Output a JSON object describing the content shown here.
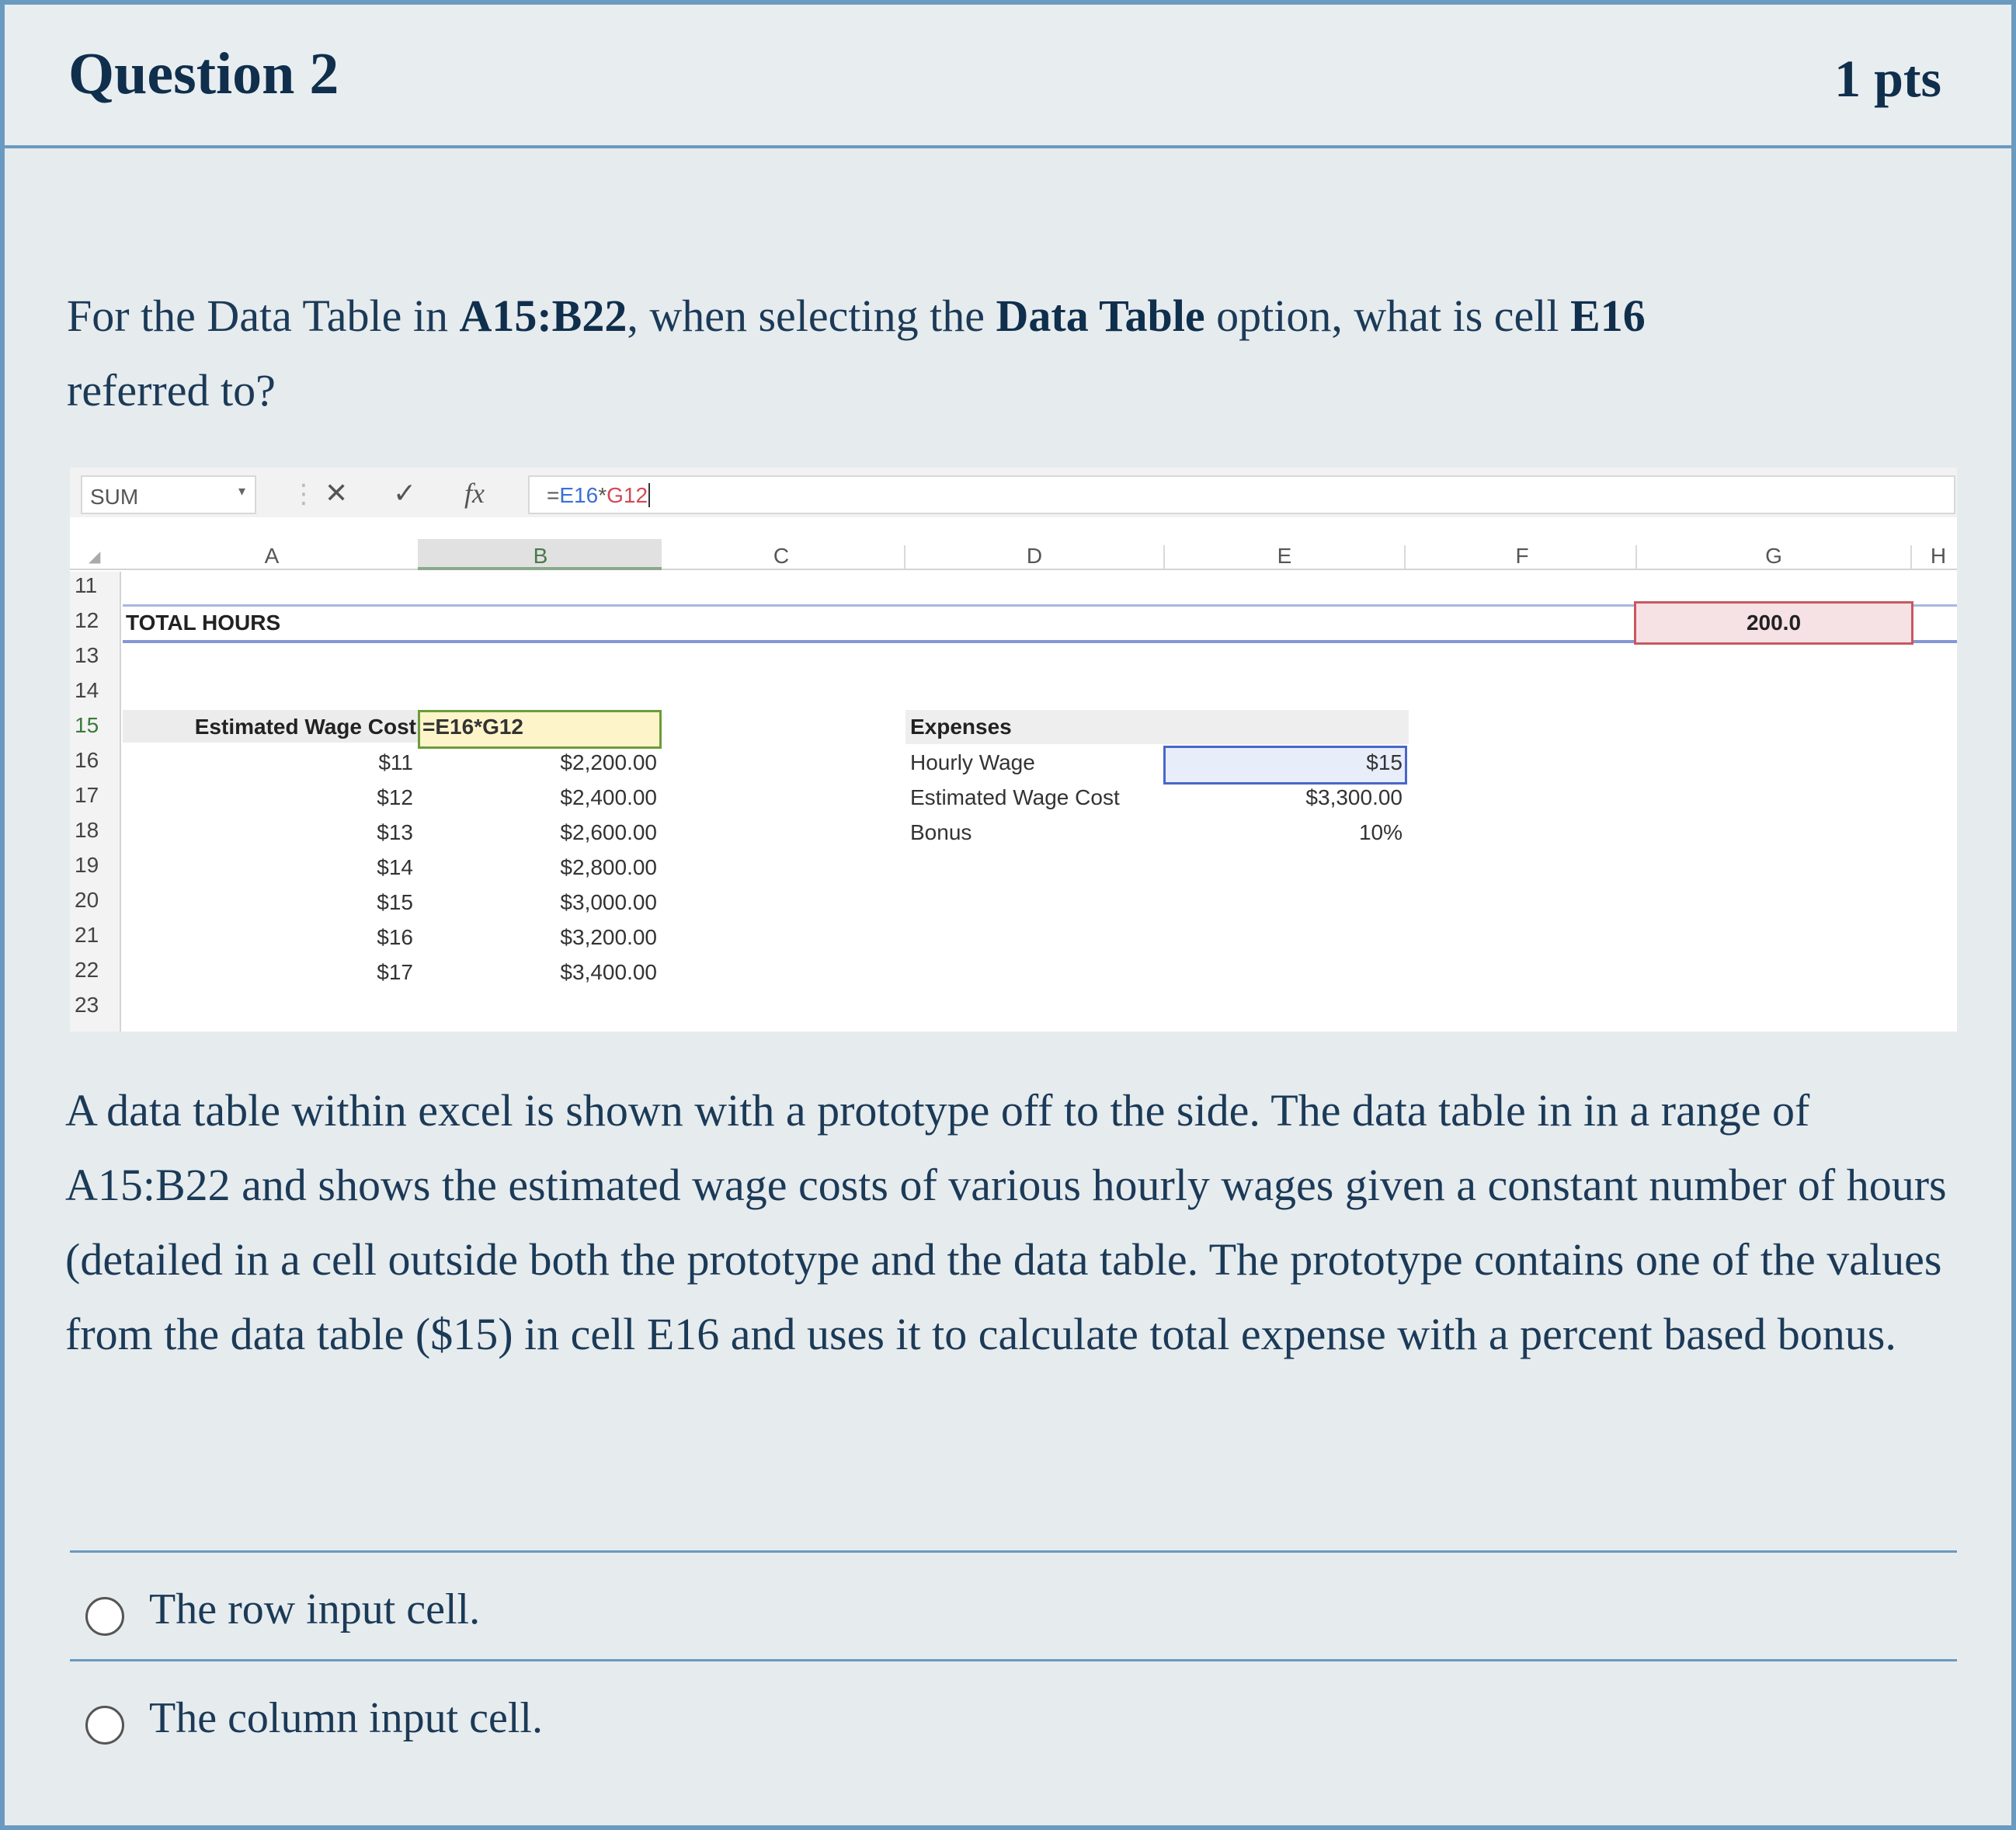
{
  "question": {
    "title": "Question 2",
    "points": "1 pts",
    "prompt_parts": [
      "For the Data Table in ",
      "A15:B22",
      ", when selecting the ",
      "Data Table",
      " option, what is cell ",
      "E16",
      " referred to?"
    ],
    "description": "A data table within excel is shown with a prototype off to the side. The data table in in a range of A15:B22 and shows the estimated wage costs of various hourly wages given a constant number of hours (detailed in a cell outside both the prototype and the data table. The prototype contains one of the values from the data table ($15) in cell E16 and uses it to calculate total expense with a percent based bonus."
  },
  "excel": {
    "name_box": "SUM",
    "formula_prefix": "=",
    "formula_ref1": "E16",
    "formula_op": "*",
    "formula_ref2": "G12",
    "columns": [
      "A",
      "B",
      "C",
      "D",
      "E",
      "F",
      "G",
      "H"
    ],
    "rows": [
      "11",
      "12",
      "13",
      "14",
      "15",
      "16",
      "17",
      "18",
      "19",
      "20",
      "21",
      "22",
      "23"
    ],
    "total_hours_label": "TOTAL HOURS",
    "total_hours_value": "200.0",
    "table_header_label": "Estimated Wage Cost",
    "table_header_formula": "=E16*G12",
    "wages": [
      "$11",
      "$12",
      "$13",
      "$14",
      "$15",
      "$16",
      "$17"
    ],
    "costs": [
      "$2,200.00",
      "$2,400.00",
      "$2,600.00",
      "$2,800.00",
      "$3,000.00",
      "$3,200.00",
      "$3,400.00"
    ],
    "prototype": {
      "title": "Expenses",
      "labels": [
        "Hourly Wage",
        "Estimated Wage Cost",
        "Bonus"
      ],
      "values": [
        "$15",
        "$3,300.00",
        "10%"
      ]
    }
  },
  "options": [
    "The row input cell.",
    "The column input cell."
  ],
  "colors": {
    "border_blue": "#6a9ac0",
    "heading_navy": "#0f2f4c",
    "highlight_yellow": "#fdf5c9",
    "highlight_red": "#f6e1e4",
    "highlight_blue": "#e8edfa"
  }
}
